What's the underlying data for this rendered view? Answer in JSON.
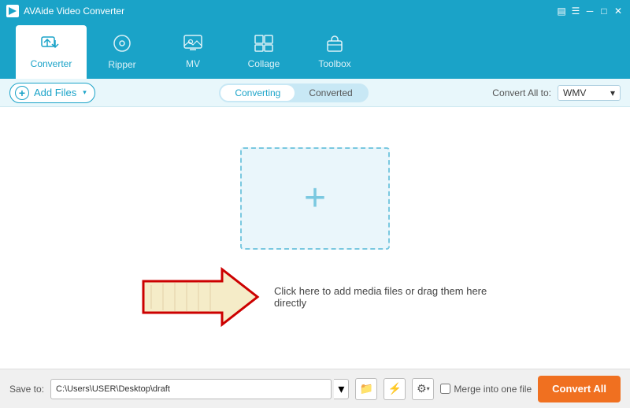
{
  "titleBar": {
    "appName": "AVAide Video Converter",
    "controls": [
      "minimize",
      "maximize",
      "close"
    ]
  },
  "nav": {
    "items": [
      {
        "id": "converter",
        "label": "Converter",
        "icon": "⇄",
        "active": true
      },
      {
        "id": "ripper",
        "label": "Ripper",
        "icon": "◎"
      },
      {
        "id": "mv",
        "label": "MV",
        "icon": "▣"
      },
      {
        "id": "collage",
        "label": "Collage",
        "icon": "⊞"
      },
      {
        "id": "toolbox",
        "label": "Toolbox",
        "icon": "⊡"
      }
    ]
  },
  "toolbar": {
    "addFilesLabel": "Add Files",
    "tabs": [
      {
        "id": "converting",
        "label": "Converting",
        "active": true
      },
      {
        "id": "converted",
        "label": "Converted"
      }
    ],
    "convertAllTo": "Convert All to:",
    "format": "WMV"
  },
  "dropZone": {
    "plusSymbol": "+",
    "hintText": "Click here to add media files or drag them here directly"
  },
  "bottomBar": {
    "saveToLabel": "Save to:",
    "savePath": "C:\\Users\\USER\\Desktop\\draft",
    "mergeLabel": "Merge into one file",
    "convertAllLabel": "Convert All"
  },
  "icons": {
    "caretDown": "▾",
    "folder": "📁",
    "lightning": "⚡",
    "settings": "⚙",
    "check": "✓"
  }
}
